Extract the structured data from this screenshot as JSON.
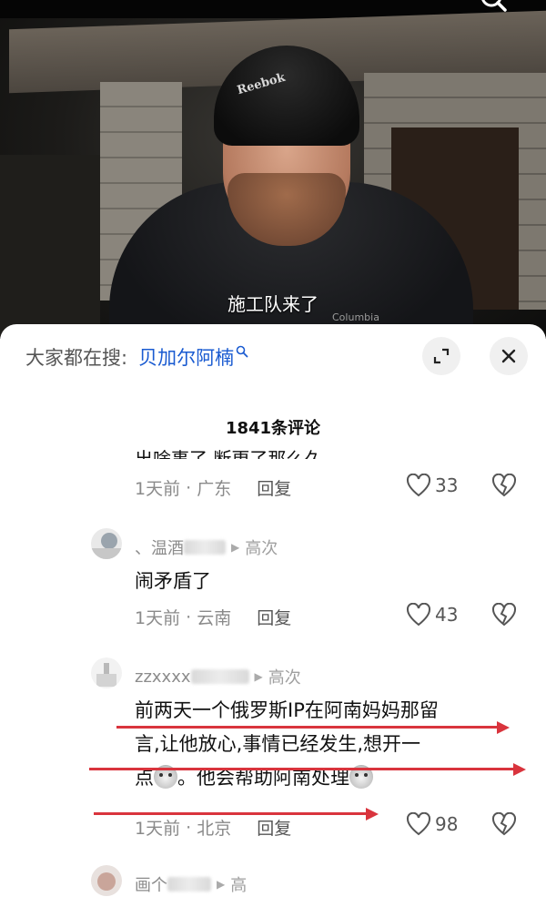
{
  "video": {
    "subtitle": "施工队来了",
    "hat_brand": "Reebok",
    "jacket_brand": "Columbia",
    "search_icon": "search-icon"
  },
  "sheet": {
    "search_prefix": "大家都在搜:",
    "search_term": "贝加尔阿楠",
    "expand_icon": "expand-icon",
    "close_icon": "close-icon",
    "comment_count": "1841条评论"
  },
  "comments": [
    {
      "text_partial": "出啥事了,断更了那么久",
      "time": "1天前",
      "location": "广东",
      "reply_label": "回复",
      "likes": "33"
    },
    {
      "username_prefix": "、温酒",
      "username_tail": "高次",
      "text": "闹矛盾了",
      "time": "1天前",
      "location": "云南",
      "reply_label": "回复",
      "likes": "43"
    },
    {
      "username_prefix": "zzxxxx",
      "username_tail": "高次",
      "text_lines": [
        "前两天一个俄罗斯IP在阿南妈妈那留",
        "言,让他放心,事情已经发生,想开一",
        "点",
        "。他会帮助阿南处理"
      ],
      "time": "1天前",
      "location": "北京",
      "reply_label": "回复",
      "likes": "98"
    },
    {
      "username_prefix": "画个",
      "username_tail": "高"
    }
  ],
  "colors": {
    "accent_link": "#1a5bd1",
    "annotation_red": "#d9343d"
  }
}
